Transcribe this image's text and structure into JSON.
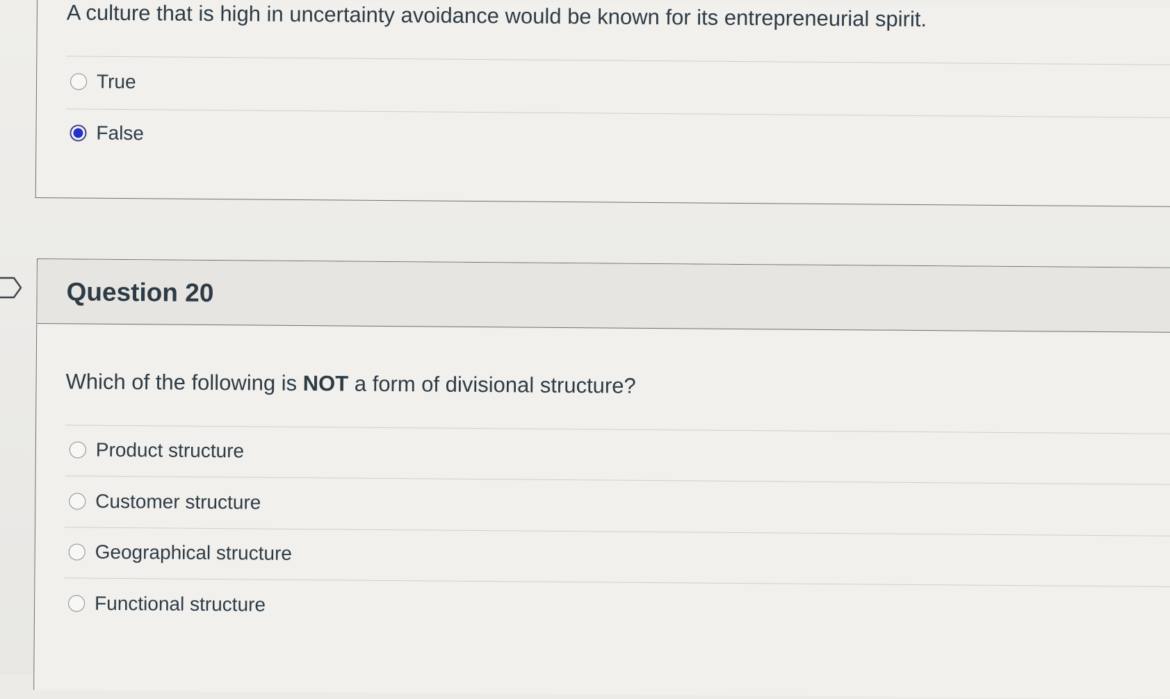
{
  "previous_question": {
    "text": "A culture that is high in uncertainty avoidance would be known for its entrepreneurial spirit.",
    "answers": [
      {
        "label": "True",
        "selected": false
      },
      {
        "label": "False",
        "selected": true
      }
    ]
  },
  "question_20": {
    "title": "Question 20",
    "text_before": "Which of the following is ",
    "text_emphasis": "NOT",
    "text_after": " a form of divisional structure?",
    "answers": [
      {
        "label": "Product structure",
        "selected": false
      },
      {
        "label": "Customer structure",
        "selected": false
      },
      {
        "label": "Geographical structure",
        "selected": false
      },
      {
        "label": "Functional structure",
        "selected": false
      }
    ]
  },
  "icons": {
    "flag": "bookmark-flag-icon",
    "radio": "radio-button-icon"
  },
  "colors": {
    "selected_radio": "#2232c9",
    "text": "#2d3b45",
    "border": "#6d6f71"
  }
}
